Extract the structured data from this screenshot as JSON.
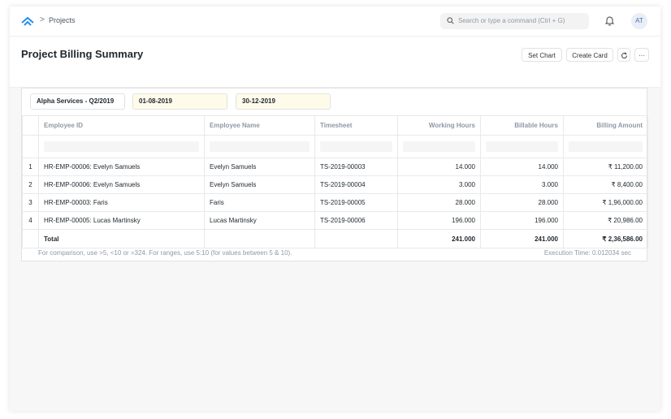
{
  "breadcrumb": {
    "separator": ">",
    "current": "Projects"
  },
  "search": {
    "placeholder": "Search or type a command (Ctrl + G)"
  },
  "user": {
    "initials": "AT"
  },
  "page": {
    "title": "Project Billing Summary",
    "actions": {
      "set_chart": "Set Chart",
      "create_card": "Create Card",
      "more": "···"
    }
  },
  "filters": {
    "company": "Alpha Services - Q2/2019",
    "from_date": "01-08-2019",
    "to_date": "30-12-2019"
  },
  "table": {
    "columns": [
      "Employee ID",
      "Employee Name",
      "Timesheet",
      "Working Hours",
      "Billable Hours",
      "Billing Amount"
    ],
    "rows": [
      {
        "idx": "1",
        "employee_id": "HR-EMP-00006: Evelyn Samuels",
        "employee_name": "Evelyn Samuels",
        "timesheet": "TS-2019-00003",
        "working_hours": "14.000",
        "billable_hours": "14.000",
        "billing_amount": "₹ 11,200.00"
      },
      {
        "idx": "2",
        "employee_id": "HR-EMP-00006: Evelyn Samuels",
        "employee_name": "Evelyn Samuels",
        "timesheet": "TS-2019-00004",
        "working_hours": "3.000",
        "billable_hours": "3.000",
        "billing_amount": "₹ 8,400.00"
      },
      {
        "idx": "3",
        "employee_id": "HR-EMP-00003: Faris",
        "employee_name": "Faris",
        "timesheet": "TS-2019-00005",
        "working_hours": "28.000",
        "billable_hours": "28.000",
        "billing_amount": "₹ 1,96,000.00"
      },
      {
        "idx": "4",
        "employee_id": "HR-EMP-00005: Lucas Martinsky",
        "employee_name": "Lucas Martinsky",
        "timesheet": "TS-2019-00006",
        "working_hours": "196.000",
        "billable_hours": "196.000",
        "billing_amount": "₹ 20,986.00"
      }
    ],
    "total": {
      "label": "Total",
      "working_hours": "241.000",
      "billable_hours": "241.000",
      "billing_amount": "₹ 2,36,586.00"
    }
  },
  "footer": {
    "help": "For comparison, use >5, <10 or =324. For ranges, use 5:10 (for values between 5 & 10).",
    "execution_time": "Execution Time: 0.012034 sec"
  },
  "colors": {
    "accent": "#2490ef",
    "date_filter_bg": "#fffbea",
    "muted_text": "#8d99a6"
  },
  "icons": [
    "app-logo-icon",
    "search-icon",
    "bell-icon",
    "refresh-icon"
  ]
}
